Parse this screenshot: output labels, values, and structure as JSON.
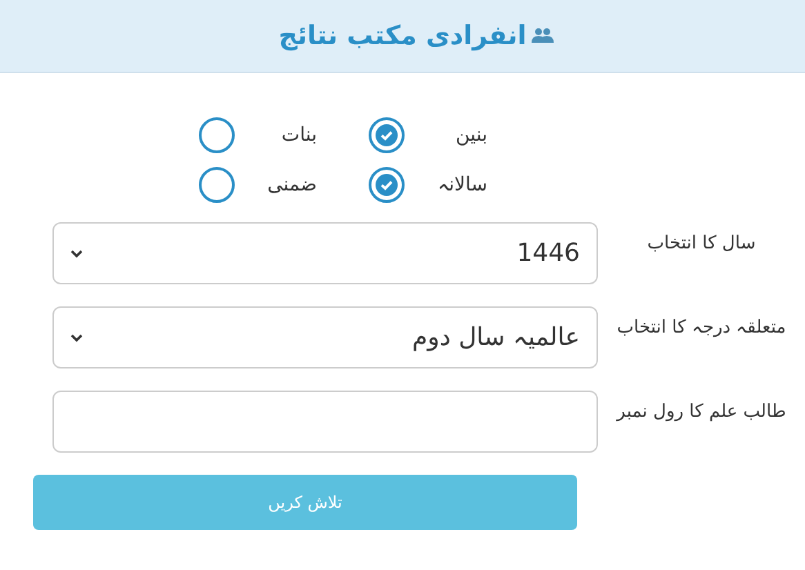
{
  "header": {
    "title": "انفرادی مکتب نتائج"
  },
  "radio_groups": [
    {
      "options": [
        {
          "label": "بنین",
          "selected": true
        },
        {
          "label": "بنات",
          "selected": false
        }
      ]
    },
    {
      "options": [
        {
          "label": "سالانہ",
          "selected": true
        },
        {
          "label": "ضمنی",
          "selected": false
        }
      ]
    }
  ],
  "fields": [
    {
      "kind": "select",
      "label": "سال کا انتخاب",
      "value": "1446"
    },
    {
      "kind": "select",
      "label": "متعلقہ درجہ کا انتخاب",
      "value": "عالمیہ سال دوم"
    },
    {
      "kind": "input",
      "label": "طالب علم کا رول نمبر"
    }
  ],
  "submit_button": "تلاش کریں"
}
